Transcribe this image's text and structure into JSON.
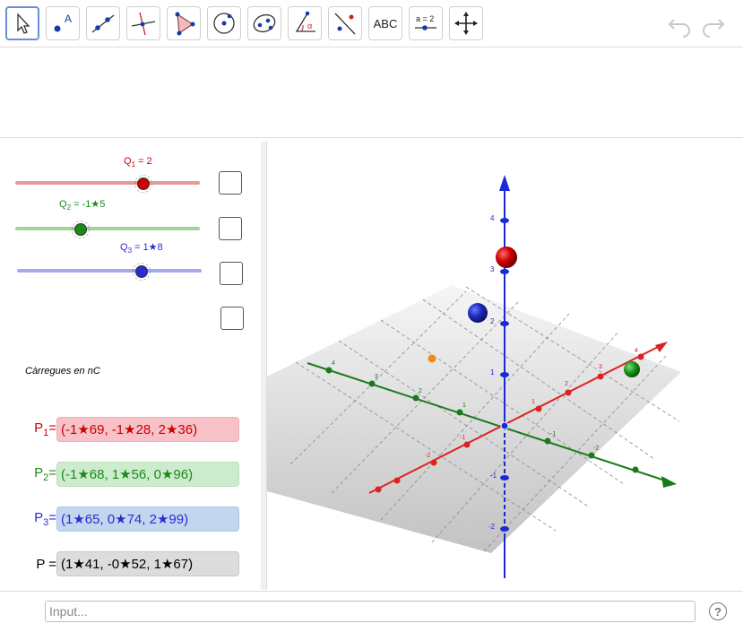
{
  "toolbar": {
    "tools": [
      {
        "id": "move",
        "icon": "arrow-pointer-icon",
        "selected": true
      },
      {
        "id": "point",
        "icon": "point-icon",
        "label": "A"
      },
      {
        "id": "line",
        "icon": "line-icon"
      },
      {
        "id": "perpendicular",
        "icon": "perpendicular-line-icon"
      },
      {
        "id": "polygon",
        "icon": "triangle-icon"
      },
      {
        "id": "circle",
        "icon": "circle-icon"
      },
      {
        "id": "conic",
        "icon": "ellipse-icon"
      },
      {
        "id": "angle",
        "icon": "angle-icon",
        "label": "α"
      },
      {
        "id": "reflect",
        "icon": "reflect-icon"
      },
      {
        "id": "text",
        "icon": "text-icon",
        "label": "ABC"
      },
      {
        "id": "slider",
        "icon": "slider-icon",
        "label": "a = 2"
      },
      {
        "id": "move-view",
        "icon": "move-view-icon"
      }
    ]
  },
  "sliders": [
    {
      "name": "Q",
      "sub": "1",
      "value_text": " = 2",
      "value": 2,
      "color": "#cc0000",
      "track_color": "#e89a9a"
    },
    {
      "name": "Q",
      "sub": "2",
      "value_text": " = -1★5",
      "value": -1.5,
      "color": "#1a8a1a",
      "track_color": "#9fd49f"
    },
    {
      "name": "Q",
      "sub": "3",
      "value_text": " = 1★8",
      "value": 1.8,
      "color": "#2b2bd6",
      "track_color": "#a6a8ee"
    }
  ],
  "caption": "Càrregues en nC",
  "points": [
    {
      "name": "P",
      "sub": "1",
      "eq": "=",
      "value": "(-1★69, -1★28, 2★36)",
      "color": "#cc0000",
      "bg": "#f7c1c7"
    },
    {
      "name": "P",
      "sub": "2",
      "eq": "=",
      "value": "(-1★68, 1★56, 0★96)",
      "color": "#1a8a1a",
      "bg": "#cdeccd"
    },
    {
      "name": "P",
      "sub": "3",
      "eq": "=",
      "value": "(1★65, 0★74, 2★99)",
      "color": "#2b2bd6",
      "bg": "#c2d6ee"
    },
    {
      "name": "P",
      "sub": "",
      "eq": " =",
      "value": "(1★41, -0★52, 1★67)",
      "color": "#000000",
      "bg": "#dcdcdc"
    }
  ],
  "input": {
    "placeholder": "Input..."
  },
  "help": {
    "label": "?"
  },
  "axes": {
    "z_ticks": [
      "4",
      "3",
      "2",
      "1",
      "-1",
      "-2"
    ],
    "x_ticks": [
      "4",
      "3",
      "2",
      "1",
      "-1",
      "-2"
    ],
    "y_ticks": [
      "4",
      "3",
      "2",
      "1",
      "-1",
      "-2"
    ]
  },
  "colors": {
    "x_axis": "#d22",
    "y_axis": "#1a7a1a",
    "z_axis": "#1a2ad6",
    "sphere_red": "#c00",
    "sphere_blue": "#1a2ab8",
    "sphere_green": "#1a9a1a",
    "point_orange": "#f08a1a"
  }
}
